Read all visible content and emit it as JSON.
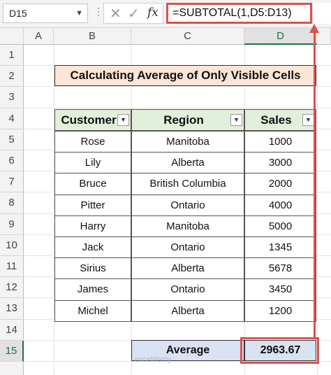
{
  "formula_bar": {
    "name_box": "D15",
    "cancel_glyph": "✕",
    "enter_glyph": "✓",
    "fx_label": "fx",
    "formula": "=SUBTOTAL(1,D5:D13)"
  },
  "columns": [
    "A",
    "B",
    "C",
    "D"
  ],
  "rows": [
    "1",
    "2",
    "3",
    "4",
    "5",
    "6",
    "7",
    "8",
    "9",
    "10",
    "11",
    "12",
    "13",
    "14",
    "15"
  ],
  "title": "Calculating Average of Only Visible Cells",
  "table": {
    "headers": [
      "Customer",
      "Region",
      "Sales"
    ],
    "rows": [
      [
        "Rose",
        "Manitoba",
        "1000"
      ],
      [
        "Lily",
        "Alberta",
        "3000"
      ],
      [
        "Bruce",
        "British Columbia",
        "2000"
      ],
      [
        "Pitter",
        "Ontario",
        "4000"
      ],
      [
        "Harry",
        "Manitoba",
        "5000"
      ],
      [
        "Jack",
        "Ontario",
        "1345"
      ],
      [
        "Sirius",
        "Alberta",
        "5678"
      ],
      [
        "James",
        "Ontario",
        "3450"
      ],
      [
        "Michel",
        "Alberta",
        "1200"
      ]
    ]
  },
  "average": {
    "label": "Average",
    "value": "2963.67"
  },
  "watermark": "exceldemy",
  "colors": {
    "highlight": "#d9534f",
    "title_bg": "#fbe5d6",
    "header_bg": "#e2efda",
    "average_bg": "#d9e1f2"
  }
}
